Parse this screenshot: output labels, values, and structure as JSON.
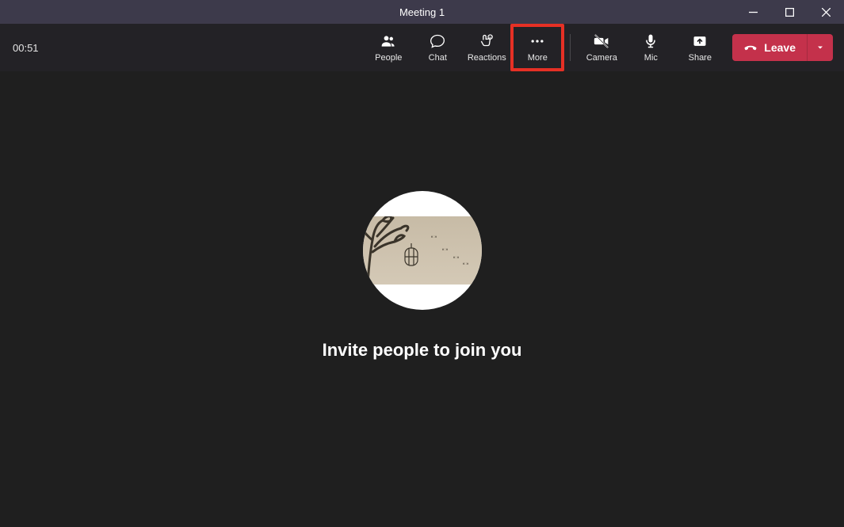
{
  "window": {
    "title": "Meeting 1"
  },
  "toolbar": {
    "timer": "00:51",
    "people": "People",
    "chat": "Chat",
    "reactions": "Reactions",
    "more": "More",
    "camera": "Camera",
    "mic": "Mic",
    "share": "Share",
    "leave": "Leave"
  },
  "main": {
    "invite_text": "Invite people to join you"
  },
  "highlight": {
    "target": "more-button"
  }
}
